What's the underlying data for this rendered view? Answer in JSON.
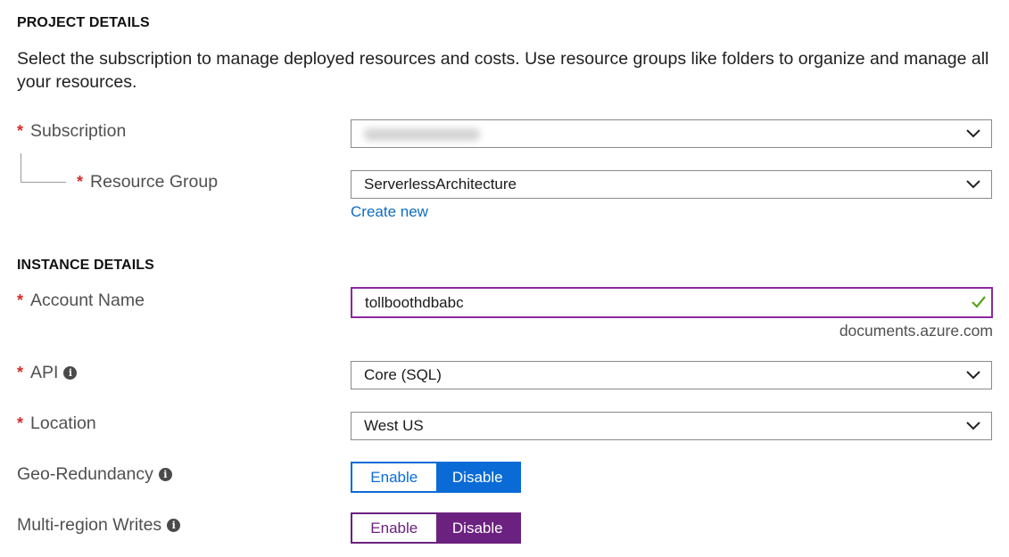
{
  "project": {
    "title": "PROJECT DETAILS",
    "description": "Select the subscription to manage deployed resources and costs. Use resource groups like folders to organize and manage all your resources.",
    "subscription": {
      "label": "Subscription",
      "required_mark": "*",
      "value": ""
    },
    "resource_group": {
      "label": "Resource Group",
      "required_mark": "*",
      "value": "ServerlessArchitecture",
      "create_new_label": "Create new"
    }
  },
  "instance": {
    "title": "INSTANCE DETAILS",
    "account_name": {
      "label": "Account Name",
      "required_mark": "*",
      "value": "tollboothdbabc",
      "suffix": "documents.azure.com",
      "valid": true
    },
    "api": {
      "label": "API",
      "required_mark": "*",
      "value": "Core (SQL)",
      "info_icon": "info-icon"
    },
    "location": {
      "label": "Location",
      "required_mark": "*",
      "value": "West US"
    },
    "geo_redundancy": {
      "label": "Geo-Redundancy",
      "enable_label": "Enable",
      "disable_label": "Disable",
      "selected": "Disable",
      "info_icon": "info-icon"
    },
    "multi_region_writes": {
      "label": "Multi-region Writes",
      "enable_label": "Enable",
      "disable_label": "Disable",
      "selected": "Disable",
      "info_icon": "info-icon"
    }
  },
  "colors": {
    "required": "#d62b2b",
    "link": "#0f6cbd",
    "geo_toggle": "#0a6bd6",
    "multi_region_toggle": "#6b217f",
    "input_focus_border": "#8a2a9e",
    "valid_check": "#5aa31c"
  }
}
